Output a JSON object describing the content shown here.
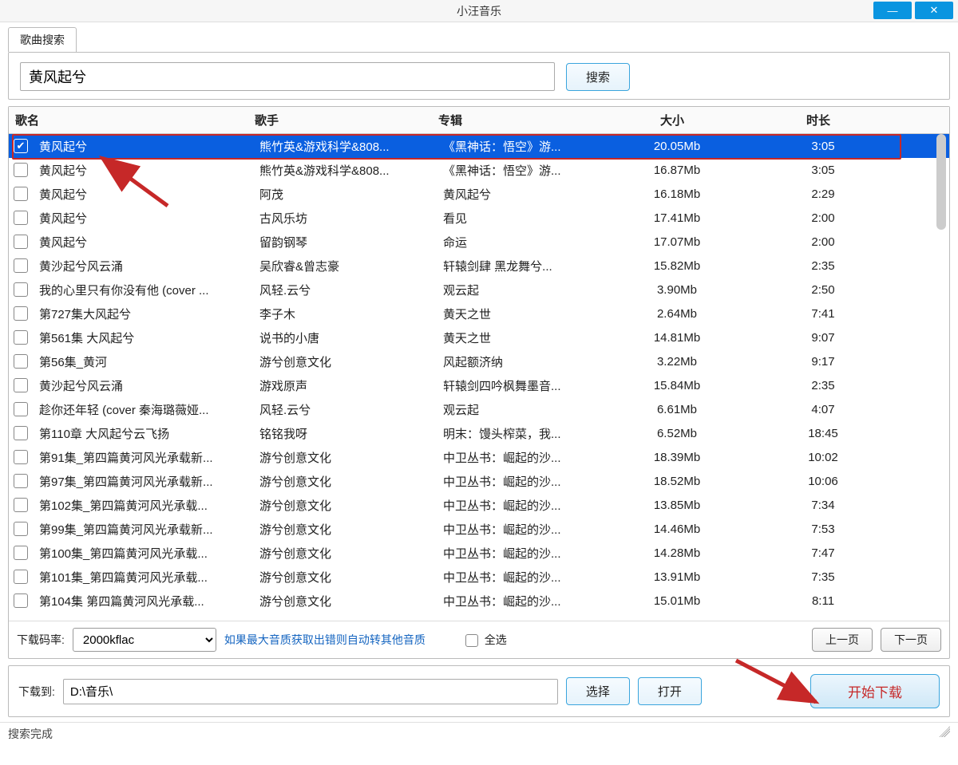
{
  "window": {
    "title": "小汪音乐"
  },
  "tab": {
    "label": "歌曲搜索"
  },
  "search": {
    "query": "黄风起兮",
    "button": "搜索"
  },
  "columns": {
    "name": "歌名",
    "artist": "歌手",
    "album": "专辑",
    "size": "大小",
    "duration": "时长"
  },
  "rows": [
    {
      "checked": true,
      "selected": true,
      "name": "黄风起兮",
      "artist": "熊竹英&游戏科学&808...",
      "album": "《黑神话：悟空》游...",
      "size": "20.05Mb",
      "duration": "3:05"
    },
    {
      "checked": false,
      "selected": false,
      "name": "黄风起兮",
      "artist": "熊竹英&游戏科学&808...",
      "album": "《黑神话：悟空》游...",
      "size": "16.87Mb",
      "duration": "3:05"
    },
    {
      "checked": false,
      "selected": false,
      "name": "黄风起兮",
      "artist": "阿茂",
      "album": "黄风起兮",
      "size": "16.18Mb",
      "duration": "2:29"
    },
    {
      "checked": false,
      "selected": false,
      "name": "黄风起兮",
      "artist": "古风乐坊",
      "album": "看见",
      "size": "17.41Mb",
      "duration": "2:00"
    },
    {
      "checked": false,
      "selected": false,
      "name": "黄风起兮",
      "artist": "留韵钢琴",
      "album": "命运",
      "size": "17.07Mb",
      "duration": "2:00"
    },
    {
      "checked": false,
      "selected": false,
      "name": "黄沙起兮风云涌",
      "artist": "吴欣睿&曾志豪",
      "album": "轩辕剑肆 黑龙舞兮...",
      "size": "15.82Mb",
      "duration": "2:35"
    },
    {
      "checked": false,
      "selected": false,
      "name": "我的心里只有你没有他 (cover ...",
      "artist": "风轻.云兮",
      "album": "观云起",
      "size": "3.90Mb",
      "duration": "2:50"
    },
    {
      "checked": false,
      "selected": false,
      "name": "第727集大风起兮",
      "artist": "李子木",
      "album": "黄天之世",
      "size": "2.64Mb",
      "duration": "7:41"
    },
    {
      "checked": false,
      "selected": false,
      "name": "第561集 大风起兮",
      "artist": "说书的小唐",
      "album": "黄天之世",
      "size": "14.81Mb",
      "duration": "9:07"
    },
    {
      "checked": false,
      "selected": false,
      "name": "第56集_黄河",
      "artist": "游兮创意文化",
      "album": "风起额济纳",
      "size": "3.22Mb",
      "duration": "9:17"
    },
    {
      "checked": false,
      "selected": false,
      "name": "黄沙起兮风云涌",
      "artist": "游戏原声",
      "album": "轩辕剑四吟枫舞墨音...",
      "size": "15.84Mb",
      "duration": "2:35"
    },
    {
      "checked": false,
      "selected": false,
      "name": "趁你还年轻 (cover 秦海璐薇娅...",
      "artist": "风轻.云兮",
      "album": "观云起",
      "size": "6.61Mb",
      "duration": "4:07"
    },
    {
      "checked": false,
      "selected": false,
      "name": "第110章 大风起兮云飞扬",
      "artist": "铭铭我呀",
      "album": "明末：馒头榨菜，我...",
      "size": "6.52Mb",
      "duration": "18:45"
    },
    {
      "checked": false,
      "selected": false,
      "name": "第91集_第四篇黄河风光承载新...",
      "artist": "游兮创意文化",
      "album": "中卫丛书：崛起的沙...",
      "size": "18.39Mb",
      "duration": "10:02"
    },
    {
      "checked": false,
      "selected": false,
      "name": "第97集_第四篇黄河风光承载新...",
      "artist": "游兮创意文化",
      "album": "中卫丛书：崛起的沙...",
      "size": "18.52Mb",
      "duration": "10:06"
    },
    {
      "checked": false,
      "selected": false,
      "name": "第102集_第四篇黄河风光承载...",
      "artist": "游兮创意文化",
      "album": "中卫丛书：崛起的沙...",
      "size": "13.85Mb",
      "duration": "7:34"
    },
    {
      "checked": false,
      "selected": false,
      "name": "第99集_第四篇黄河风光承载新...",
      "artist": "游兮创意文化",
      "album": "中卫丛书：崛起的沙...",
      "size": "14.46Mb",
      "duration": "7:53"
    },
    {
      "checked": false,
      "selected": false,
      "name": "第100集_第四篇黄河风光承载...",
      "artist": "游兮创意文化",
      "album": "中卫丛书：崛起的沙...",
      "size": "14.28Mb",
      "duration": "7:47"
    },
    {
      "checked": false,
      "selected": false,
      "name": "第101集_第四篇黄河风光承载...",
      "artist": "游兮创意文化",
      "album": "中卫丛书：崛起的沙...",
      "size": "13.91Mb",
      "duration": "7:35"
    },
    {
      "checked": false,
      "selected": false,
      "name": "第104集 第四篇黄河风光承载...",
      "artist": "游兮创意文化",
      "album": "中卫丛书：崛起的沙...",
      "size": "15.01Mb",
      "duration": "8:11"
    }
  ],
  "footer": {
    "bitrate_label": "下载码率:",
    "bitrate_value": "2000kflac",
    "note": "如果最大音质获取出错则自动转其他音质",
    "select_all": "全选",
    "prev": "上一页",
    "next": "下一页",
    "path_label": "下载到:",
    "path_value": "D:\\音乐\\",
    "choose": "选择",
    "open": "打开",
    "start": "开始下载"
  },
  "status": "搜索完成"
}
